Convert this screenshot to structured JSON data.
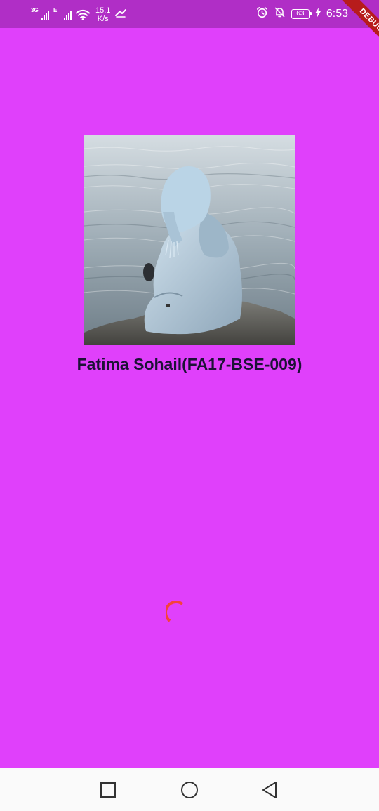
{
  "status_bar": {
    "signal_1_network": "3G",
    "signal_2_network": "E",
    "net_speed_value": "15.1",
    "net_speed_unit": "K/s",
    "battery_level": "63",
    "time": "6:53",
    "icons": [
      "signal-icon",
      "signal-icon",
      "wifi-icon",
      "data-saver-icon",
      "alarm-icon",
      "notifications-off-icon",
      "battery-icon",
      "charging-icon"
    ]
  },
  "debug_banner": {
    "label": "DEBUG",
    "color": "#b71c1c"
  },
  "profile": {
    "name": "Fatima Sohail(FA17-BSE-009)",
    "photo_alt": "woman-in-hijab-by-sea"
  },
  "loader": {
    "color": "#f4433a",
    "state": "loading"
  },
  "nav_bar": {
    "buttons": [
      "recent-apps",
      "home",
      "back"
    ]
  },
  "colors": {
    "background": "#e040fb",
    "status_bar": "#b02ec6",
    "name_text": "#1c1236",
    "nav_bar": "#fafafa"
  }
}
